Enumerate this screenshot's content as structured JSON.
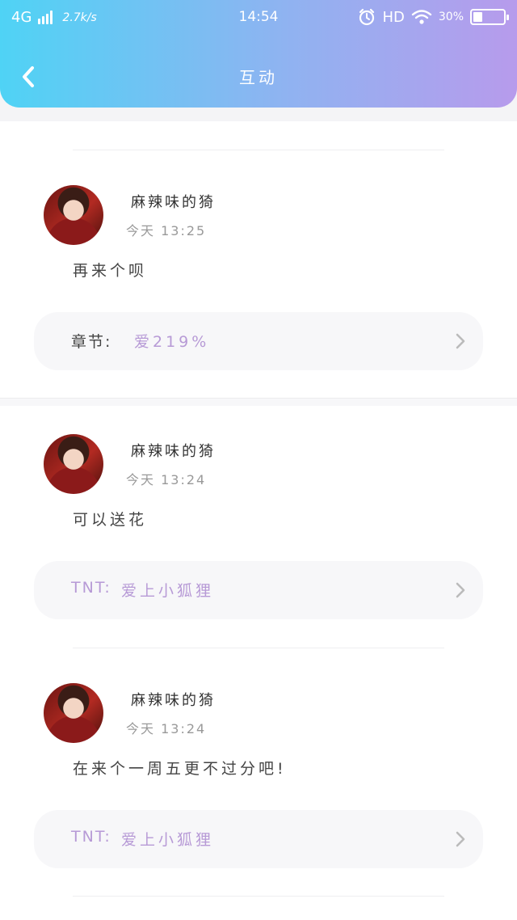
{
  "status_bar": {
    "network": "4G",
    "speed": "2.7k/s",
    "time": "14:54",
    "hd": "HD",
    "battery_percent": "30%",
    "battery_level": 0.3
  },
  "header": {
    "title": "互动"
  },
  "comments": [
    {
      "username": "麻辣味的猗",
      "time": "今天 13:25",
      "message": "再来个呗",
      "ref_label": "章节:",
      "ref_value": "爱219%"
    },
    {
      "username": "麻辣味的猗",
      "time": "今天 13:24",
      "message": "可以送花",
      "ref_label": "TNT:",
      "ref_value": "爱上小狐狸"
    },
    {
      "username": "麻辣味的猗",
      "time": "今天 13:24",
      "message": "在来个一周五更不过分吧!",
      "ref_label": "TNT:",
      "ref_value": "爱上小狐狸"
    }
  ],
  "colors": {
    "gradient_start": "#4fd3f5",
    "gradient_end": "#b79bec",
    "accent_purple": "#b79ad6"
  }
}
